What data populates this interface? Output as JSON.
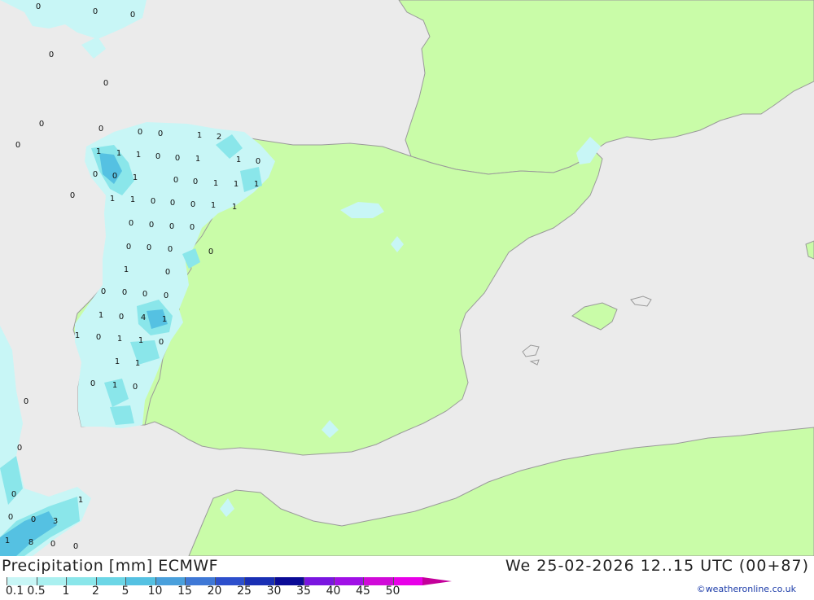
{
  "title": {
    "variable": "Precipitation [mm]",
    "model": "ECMWF",
    "datetime": "We 25-02-2026 12..15 UTC (00+87)"
  },
  "credit": "©weatheronline.co.uk",
  "legend": {
    "ticks": [
      "0.1",
      "0.5",
      "1",
      "2",
      "5",
      "10",
      "15",
      "20",
      "25",
      "30",
      "35",
      "40",
      "45",
      "50"
    ],
    "colors": [
      "#c8f6f6",
      "#aaf0f0",
      "#8ae6ea",
      "#6cd6e6",
      "#55c1e2",
      "#4aa0dc",
      "#3f78d6",
      "#2d4fcc",
      "#1a2fb4",
      "#0a0a96",
      "#7a16e0",
      "#a010e6",
      "#d00ad8",
      "#e800e8",
      "#c4009a"
    ]
  },
  "colors": {
    "sea": "#ebebeb",
    "land": "#c9fca8",
    "border": "#9a9a9a"
  },
  "point_values": [
    "0",
    "0",
    "0",
    "0",
    "0",
    "0",
    "0",
    "0",
    "0",
    "0",
    "1",
    "2",
    "1",
    "1",
    "1",
    "0",
    "0",
    "1",
    "1",
    "0",
    "0",
    "0",
    "1",
    "0",
    "0",
    "1",
    "1",
    "1",
    "1",
    "1",
    "0",
    "0",
    "0",
    "1",
    "1",
    "0",
    "0",
    "0",
    "0",
    "0",
    "0",
    "0",
    "0",
    "0",
    "1",
    "0",
    "0",
    "0",
    "0",
    "0",
    "1",
    "4",
    "1",
    "0",
    "1",
    "1",
    "0",
    "1",
    "1",
    "0",
    "1",
    "1",
    "0",
    "0",
    "0",
    "0",
    "0",
    "0",
    "1",
    "0",
    "3",
    "1",
    "8",
    "0",
    "0"
  ]
}
